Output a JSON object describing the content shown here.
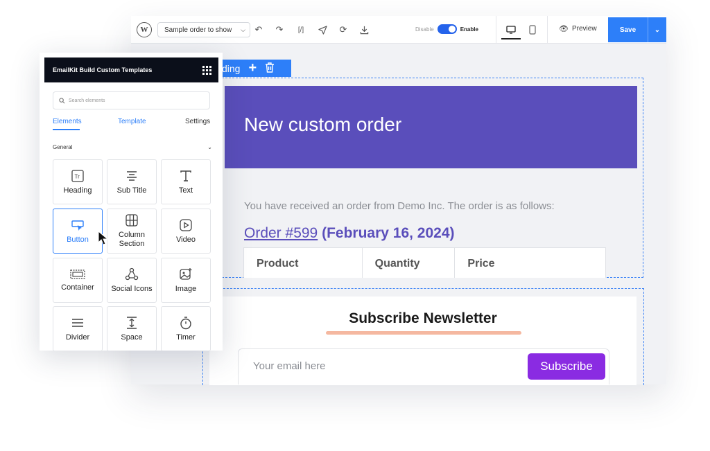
{
  "toolbar": {
    "template_select": "Sample order to show",
    "code_label": "[/]",
    "disable_label": "Disable",
    "enable_label": "Enable",
    "preview_label": "Preview",
    "save_label": "Save"
  },
  "block_toolbar": {
    "label": "ding"
  },
  "email": {
    "hero_title": "New custom order",
    "received_text": "You have received an order from Demo Inc. The order is as follows:",
    "order_link": "Order #599",
    "order_date": "(February 16, 2024)",
    "table_headers": [
      "Product",
      "Quantity",
      "Price"
    ],
    "newsletter_title": "Subscribe Newsletter",
    "email_placeholder": "Your email here",
    "subscribe_label": "Subscribe"
  },
  "panel": {
    "title": "EmailKit Build Custom Templates",
    "search_placeholder": "Search elements",
    "tabs": [
      "Elements",
      "Template",
      "Settings"
    ],
    "section_title": "General",
    "items": [
      {
        "label": "Heading",
        "icon": "heading-icon"
      },
      {
        "label": "Sub Title",
        "icon": "subtitle-icon"
      },
      {
        "label": "Text",
        "icon": "text-icon"
      },
      {
        "label": "Button",
        "icon": "button-icon"
      },
      {
        "label": "Column Section",
        "icon": "column-icon"
      },
      {
        "label": "Video",
        "icon": "video-icon"
      },
      {
        "label": "Container",
        "icon": "container-icon"
      },
      {
        "label": "Social Icons",
        "icon": "social-icon"
      },
      {
        "label": "Image",
        "icon": "image-icon"
      },
      {
        "label": "Divider",
        "icon": "divider-icon"
      },
      {
        "label": "Space",
        "icon": "space-icon"
      },
      {
        "label": "Timer",
        "icon": "timer-icon"
      }
    ]
  },
  "colors": {
    "accent": "#2d7ff9",
    "hero": "#5a4ebb",
    "subscribe": "#8a2be2",
    "underline": "#f5b8a0"
  }
}
